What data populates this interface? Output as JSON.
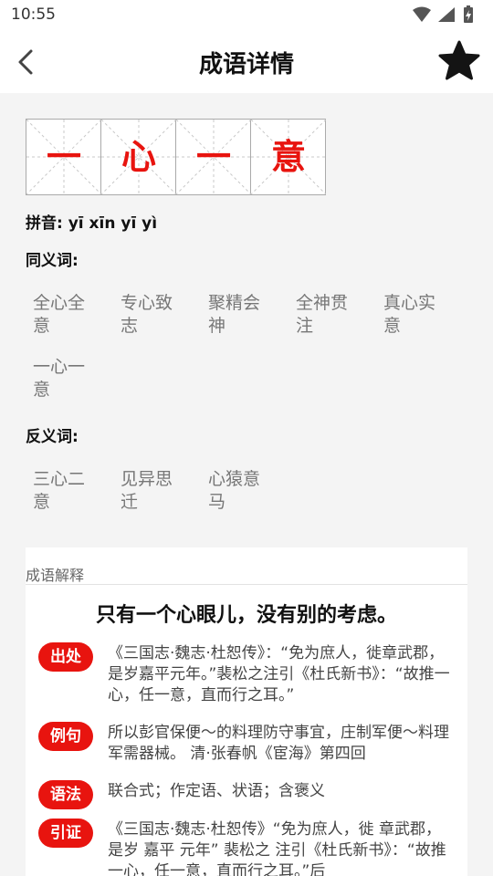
{
  "status_bar": {
    "time": "10:55",
    "icons": [
      "wifi-icon",
      "signal-icon",
      "battery-icon"
    ]
  },
  "header": {
    "title": "成语详情",
    "back_icon": "chevron-left-icon",
    "favorite_icon": "star-icon"
  },
  "idiom": {
    "characters": [
      "一",
      "心",
      "一",
      "意"
    ],
    "pinyin_label": "拼音: yī xīn yī yì"
  },
  "synonyms": {
    "label": "同义词:",
    "items": [
      "全心全意",
      "专心致志",
      "聚精会神",
      "全神贯注",
      "真心实意",
      "一心一意"
    ]
  },
  "antonyms": {
    "label": "反义词:",
    "items": [
      "三心二意",
      "见异思迁",
      "心猿意马"
    ]
  },
  "explanation": {
    "label": "成语解释",
    "meaning": "只有一个心眼儿，没有别的考虑。",
    "entries": [
      {
        "tag": "出处",
        "text": "《三国志·魏志·杜恕传》：“免为庶人，徙章武郡，是岁嘉平元年。”裴松之注引《杜氏新书》：“故推一心，任一意，直而行之耳。”"
      },
      {
        "tag": "例句",
        "text": "所以彭官保便～的料理防守事宜，庄制军便～料理军需器械。 清·张春帆《宦海》第四回"
      },
      {
        "tag": "语法",
        "text": "联合式；作定语、状语；含褒义"
      },
      {
        "tag": "引证",
        "text": "《三国志·魏志·杜恕传》“免为庶人，徙 章武郡，是岁 嘉平 元年” 裴松之 注引《杜氏新书》：“故推一心，任一意，直而行之耳。”后"
      }
    ]
  },
  "colors": {
    "accent": "#e8140f",
    "muted_text": "#777777",
    "background": "#f4f4f4"
  }
}
